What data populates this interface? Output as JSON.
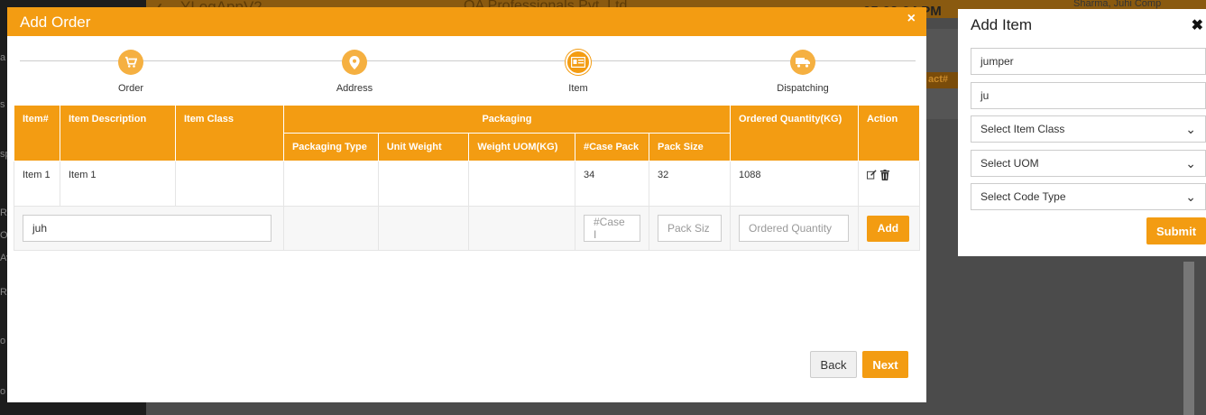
{
  "background": {
    "app_title": "YLogAppV2",
    "company": "QA Professionals Pvt. Ltd.",
    "time": "05:02:04 PM",
    "user": "Sharma, Juhi Comp",
    "tag": "act#"
  },
  "modal": {
    "title": "Add Order",
    "close_icon": "×",
    "steps": [
      {
        "label": "Order",
        "icon": "cart-icon"
      },
      {
        "label": "Address",
        "icon": "map-pin-icon"
      },
      {
        "label": "Item",
        "icon": "id-card-icon"
      },
      {
        "label": "Dispatching",
        "icon": "truck-icon"
      }
    ],
    "active_step": 2,
    "table": {
      "headers": {
        "item_no": "Item#",
        "item_desc": "Item Description",
        "item_class": "Item Class",
        "packaging": "Packaging",
        "ordered_qty": "Ordered Quantity(KG)",
        "action": "Action",
        "packaging_type": "Packaging Type",
        "unit_weight": "Unit Weight",
        "weight_uom": "Weight UOM(KG)",
        "case_pack": "#Case Pack",
        "pack_size": "Pack Size"
      },
      "rows": [
        {
          "item_no": "Item 1",
          "item_desc": "Item 1",
          "item_class": "",
          "packaging_type": "",
          "unit_weight": "",
          "weight_uom": "",
          "case_pack": "34",
          "pack_size": "32",
          "ordered_qty": "1088"
        }
      ],
      "input_row": {
        "item_value": "juh",
        "case_pack_placeholder": "#Case I",
        "pack_size_placeholder": "Pack Siz",
        "ordered_qty_placeholder": "Ordered Quantity",
        "add_label": "Add"
      }
    },
    "back_label": "Back",
    "next_label": "Next"
  },
  "add_item": {
    "title": "Add Item",
    "close_icon": "✖",
    "field1_value": "jumper",
    "field2_value": "ju",
    "select_item_class": "Select Item Class",
    "select_uom": "Select UOM",
    "select_code_type": "Select Code Type",
    "submit_label": "Submit"
  },
  "colors": {
    "accent": "#f39c12",
    "accent_light": "#f5b041"
  }
}
